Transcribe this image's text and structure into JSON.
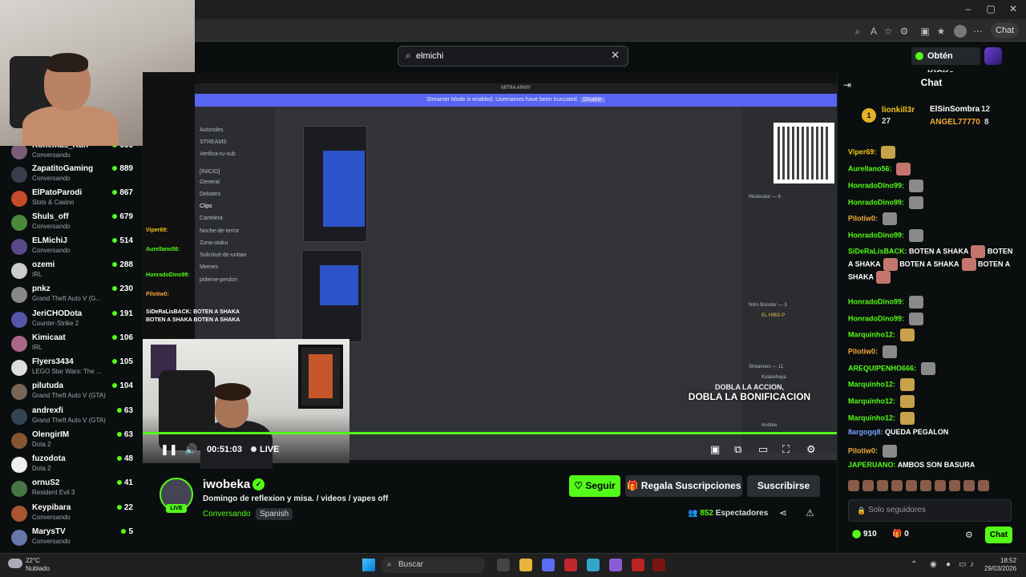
{
  "browser": {
    "chat_button": "Chat",
    "window_controls": [
      "–",
      "▢",
      "✕"
    ]
  },
  "header": {
    "search_value": "elmichi",
    "kicks_button": "Obtén KICKs"
  },
  "sidebar": {
    "items": [
      {
        "name": "Ronemas_Run",
        "category": "Conversando",
        "viewers": "666"
      },
      {
        "name": "ZapatitoGaming",
        "category": "Conversando",
        "viewers": "889"
      },
      {
        "name": "ElPatoParodi",
        "category": "Slots & Casino",
        "viewers": "867"
      },
      {
        "name": "Shuls_off",
        "category": "Conversando",
        "viewers": "679"
      },
      {
        "name": "ELMichiJ",
        "category": "Conversando",
        "viewers": "514"
      },
      {
        "name": "ozemi",
        "category": "IRL",
        "viewers": "288"
      },
      {
        "name": "pnkz",
        "category": "Grand Theft Auto V (G...",
        "viewers": "230"
      },
      {
        "name": "JeriCHODota",
        "category": "Counter-Strike 2",
        "viewers": "191"
      },
      {
        "name": "Kimicaat",
        "category": "IRL",
        "viewers": "106"
      },
      {
        "name": "Flyers3434",
        "category": "LEGO Star Wars: The ...",
        "viewers": "105"
      },
      {
        "name": "pilutuda",
        "category": "Grand Theft Auto V (GTA)",
        "viewers": "104"
      },
      {
        "name": "andrexfi",
        "category": "Grand Theft Auto V (GTA)",
        "viewers": "63"
      },
      {
        "name": "OlengirIM",
        "category": "Dota 2",
        "viewers": "63"
      },
      {
        "name": "fuzodota",
        "category": "Dota 2",
        "viewers": "48"
      },
      {
        "name": "ornuS2",
        "category": "Resident Evil 3",
        "viewers": "41"
      },
      {
        "name": "Keypibara",
        "category": "Conversando",
        "viewers": "22"
      },
      {
        "name": "MarysTV",
        "category": "Conversando",
        "viewers": "5"
      }
    ]
  },
  "video": {
    "discord_title": "MITRA ARMY",
    "streamer_mode": "Streamer Mode is enabled. Usernames have been truncated.",
    "streamer_mode_btn": "Disable",
    "channels": [
      "Autoroles",
      "STREAMS",
      "Verifica-tu-sub",
      "[INICIO]",
      "General",
      "Debates",
      "Clips",
      "Cartelera",
      "Noche-de-terror",
      "Zona-otaku",
      "Solicitud-de-unban",
      "Memes",
      "pideme-perdon"
    ],
    "members": [
      "Moderator — 6",
      "Nitro Booster — 3",
      "EL HIBO P",
      "Streamers — 11",
      "Kutarehaya",
      "Andree"
    ],
    "overlay_chat": [
      "Viper69:",
      "Aurellano56:",
      "HonradoDino99:",
      "Pilotiw0:",
      "SiDeRaLisBACK: BOTEN A SHAKA",
      "BOTEN A SHAKA BOTEN A SHAKA"
    ],
    "caption_line1": "DOBLA LA ACCION,",
    "caption_line2": "DOBLA LA BONIFICACION",
    "time": "00:51:03",
    "live": "LIVE",
    "progress": 1.0
  },
  "streamer": {
    "name": "iwobeka",
    "live_badge": "LIVE",
    "title": "Domingo de reflexion y misa.  /  videos / yapes off",
    "category": "Conversando",
    "language": "Spanish",
    "follow": "Seguir",
    "gift_subs": "Regala Suscripciones",
    "subscribe": "Suscribirse",
    "viewers_count": "852",
    "viewers_label": "Espectadores"
  },
  "chat": {
    "title": "Chat",
    "top_gifters": [
      {
        "name": "lionkill3r",
        "count": "27"
      },
      {
        "name": "ElSinSombra",
        "count": "12"
      },
      {
        "name": "ANGEL77770",
        "count": "8"
      }
    ],
    "messages": [
      {
        "user": "Viper69:",
        "text": "",
        "color": "#f0c419"
      },
      {
        "user": "Aurellano56:",
        "text": "",
        "color": "#53fc18"
      },
      {
        "user": "HonradoDino99:",
        "text": "",
        "color": "#53fc18"
      },
      {
        "user": "HonradoDino99:",
        "text": "",
        "color": "#53fc18"
      },
      {
        "user": "Pilotiw0:",
        "text": "",
        "color": "#f2a93b"
      },
      {
        "user": "HonradoDino99:",
        "text": "",
        "color": "#53fc18"
      },
      {
        "user": "HonradoDino99:",
        "text": "",
        "color": "#53fc18"
      },
      {
        "user": "HonradoDino99:",
        "text": "",
        "color": "#53fc18"
      },
      {
        "user": "Marquinho12:",
        "text": "",
        "color": "#53fc18"
      },
      {
        "user": "Pilotiw0:",
        "text": "",
        "color": "#f2a93b"
      },
      {
        "user": "AREQUIPENHO666:",
        "text": "",
        "color": "#53fc18"
      },
      {
        "user": "Marquinho12:",
        "text": "",
        "color": "#53fc18"
      },
      {
        "user": "Marquinho12:",
        "text": "",
        "color": "#53fc18"
      },
      {
        "user": "Marquinho12:",
        "text": "",
        "color": "#53fc18"
      },
      {
        "user": "8argogq8:",
        "text": "QUEDA PEGALON",
        "color": "#7aa2ff"
      },
      {
        "user": "Pilotiw0:",
        "text": "",
        "color": "#f2a93b"
      },
      {
        "user": "JAPERUANO:",
        "text": "AMBOS SON BASURA",
        "color": "#53fc18"
      }
    ],
    "shaka_user": "SiDeRaLisBACK:",
    "shaka_text": "BOTEN A SHAKA",
    "input_placeholder": "Solo seguidores",
    "kick_points": "910",
    "gifts": "0",
    "send": "Chat"
  },
  "taskbar": {
    "temp": "22°C",
    "weather": "Nublado",
    "search": "Buscar",
    "time": "18:52",
    "date": "29/03/2026"
  }
}
